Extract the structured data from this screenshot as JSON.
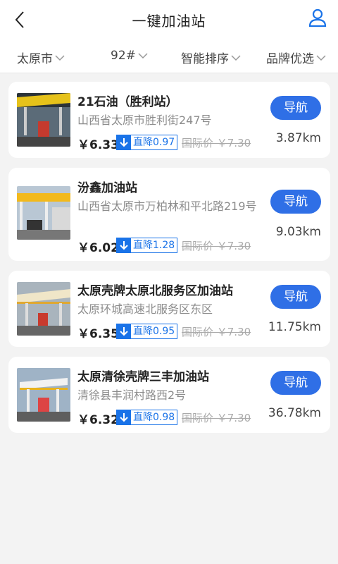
{
  "header": {
    "title": "一键加油站"
  },
  "filters": [
    {
      "label": "太原市"
    },
    {
      "label": "92#"
    },
    {
      "label": "智能排序"
    },
    {
      "label": "品牌优选"
    }
  ],
  "stations": [
    {
      "name": "21石油（胜利站）",
      "address": "山西省太原市胜利街247号",
      "price": "￥6.33",
      "drop": "直降0.97",
      "intl_price": "国际价 ￥7.30",
      "nav_label": "导航",
      "distance": "3.87km"
    },
    {
      "name": "汾鑫加油站",
      "address": "山西省太原市万柏林和平北路219号",
      "price": "￥6.02",
      "drop": "直降1.28",
      "intl_price": "国际价 ￥7.30",
      "nav_label": "导航",
      "distance": "9.03km"
    },
    {
      "name": "太原壳牌太原北服务区加油站",
      "address": "太原环城高速北服务区东区",
      "price": "￥6.35",
      "drop": "直降0.95",
      "intl_price": "国际价 ￥7.30",
      "nav_label": "导航",
      "distance": "11.75km"
    },
    {
      "name": "太原清徐壳牌三丰加油站",
      "address": "清徐县丰润村路西2号",
      "price": "￥6.32",
      "drop": "直降0.98",
      "intl_price": "国际价 ￥7.30",
      "nav_label": "导航",
      "distance": "36.78km"
    }
  ],
  "colors": {
    "accent": "#2f6fe6",
    "background": "#f3f3f3"
  },
  "icons": {
    "back": "chevron-left-icon",
    "user": "user-icon",
    "dropdown": "chevron-down-icon",
    "drop": "arrow-down-icon"
  }
}
